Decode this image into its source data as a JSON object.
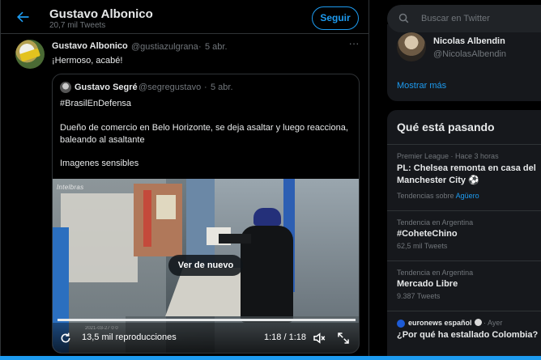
{
  "header": {
    "name": "Gustavo Albonico",
    "tweet_count": "20,7 mil Tweets",
    "follow_label": "Seguir"
  },
  "tweet": {
    "author_name": "Gustavo Albonico",
    "author_handle": "@gustiazulgrana",
    "separator": "·",
    "date": "5 abr.",
    "more": "···",
    "text": "¡Hermoso, acabé!"
  },
  "quote": {
    "author_name": "Gustavo Segré",
    "author_handle": "@segregustavo",
    "separator": "·",
    "date": "5 abr.",
    "hashtag": "#BrasilEnDefensa",
    "body": "Dueño de comercio en Belo Horizonte, se deja asaltar y luego reacciona, baleando al asaltante",
    "sensitive": "Imagenes sensibles",
    "video": {
      "logo": "Intelbras",
      "replay_label": "Ver de nuevo",
      "views": "13,5 mil reproducciones",
      "time": "1:18 / 1:18",
      "progress": 1.0,
      "stamp": "2021-03-27 0 0"
    }
  },
  "search": {
    "placeholder": "Buscar en Twitter"
  },
  "who_to_follow": {
    "name": "Nicolas Albendin",
    "handle": "@NicolasAlbendin",
    "show_more": "Mostrar más"
  },
  "trends": {
    "title": "Qué está pasando",
    "items": [
      {
        "meta": "Premier League · Hace 3 horas",
        "title": "PL: Chelsea remonta en casa del Manchester City ⚽",
        "sub_prefix": "Tendencias sobre",
        "sub_link": "Agüero"
      },
      {
        "meta": "Tendencia en Argentina",
        "title": "#CoheteChino",
        "sub": "62,5 mil Tweets"
      },
      {
        "meta": "Tendencia en Argentina",
        "title": "Mercado Libre",
        "sub": "9.387 Tweets"
      },
      {
        "meta_source": "euronews español",
        "meta_time": "· Ayer",
        "title": "¿Por qué ha estallado Colombia?"
      }
    ]
  },
  "colors": {
    "accent": "#1d9bf0",
    "background": "#000000",
    "card": "#16181c",
    "muted": "#71767b"
  }
}
